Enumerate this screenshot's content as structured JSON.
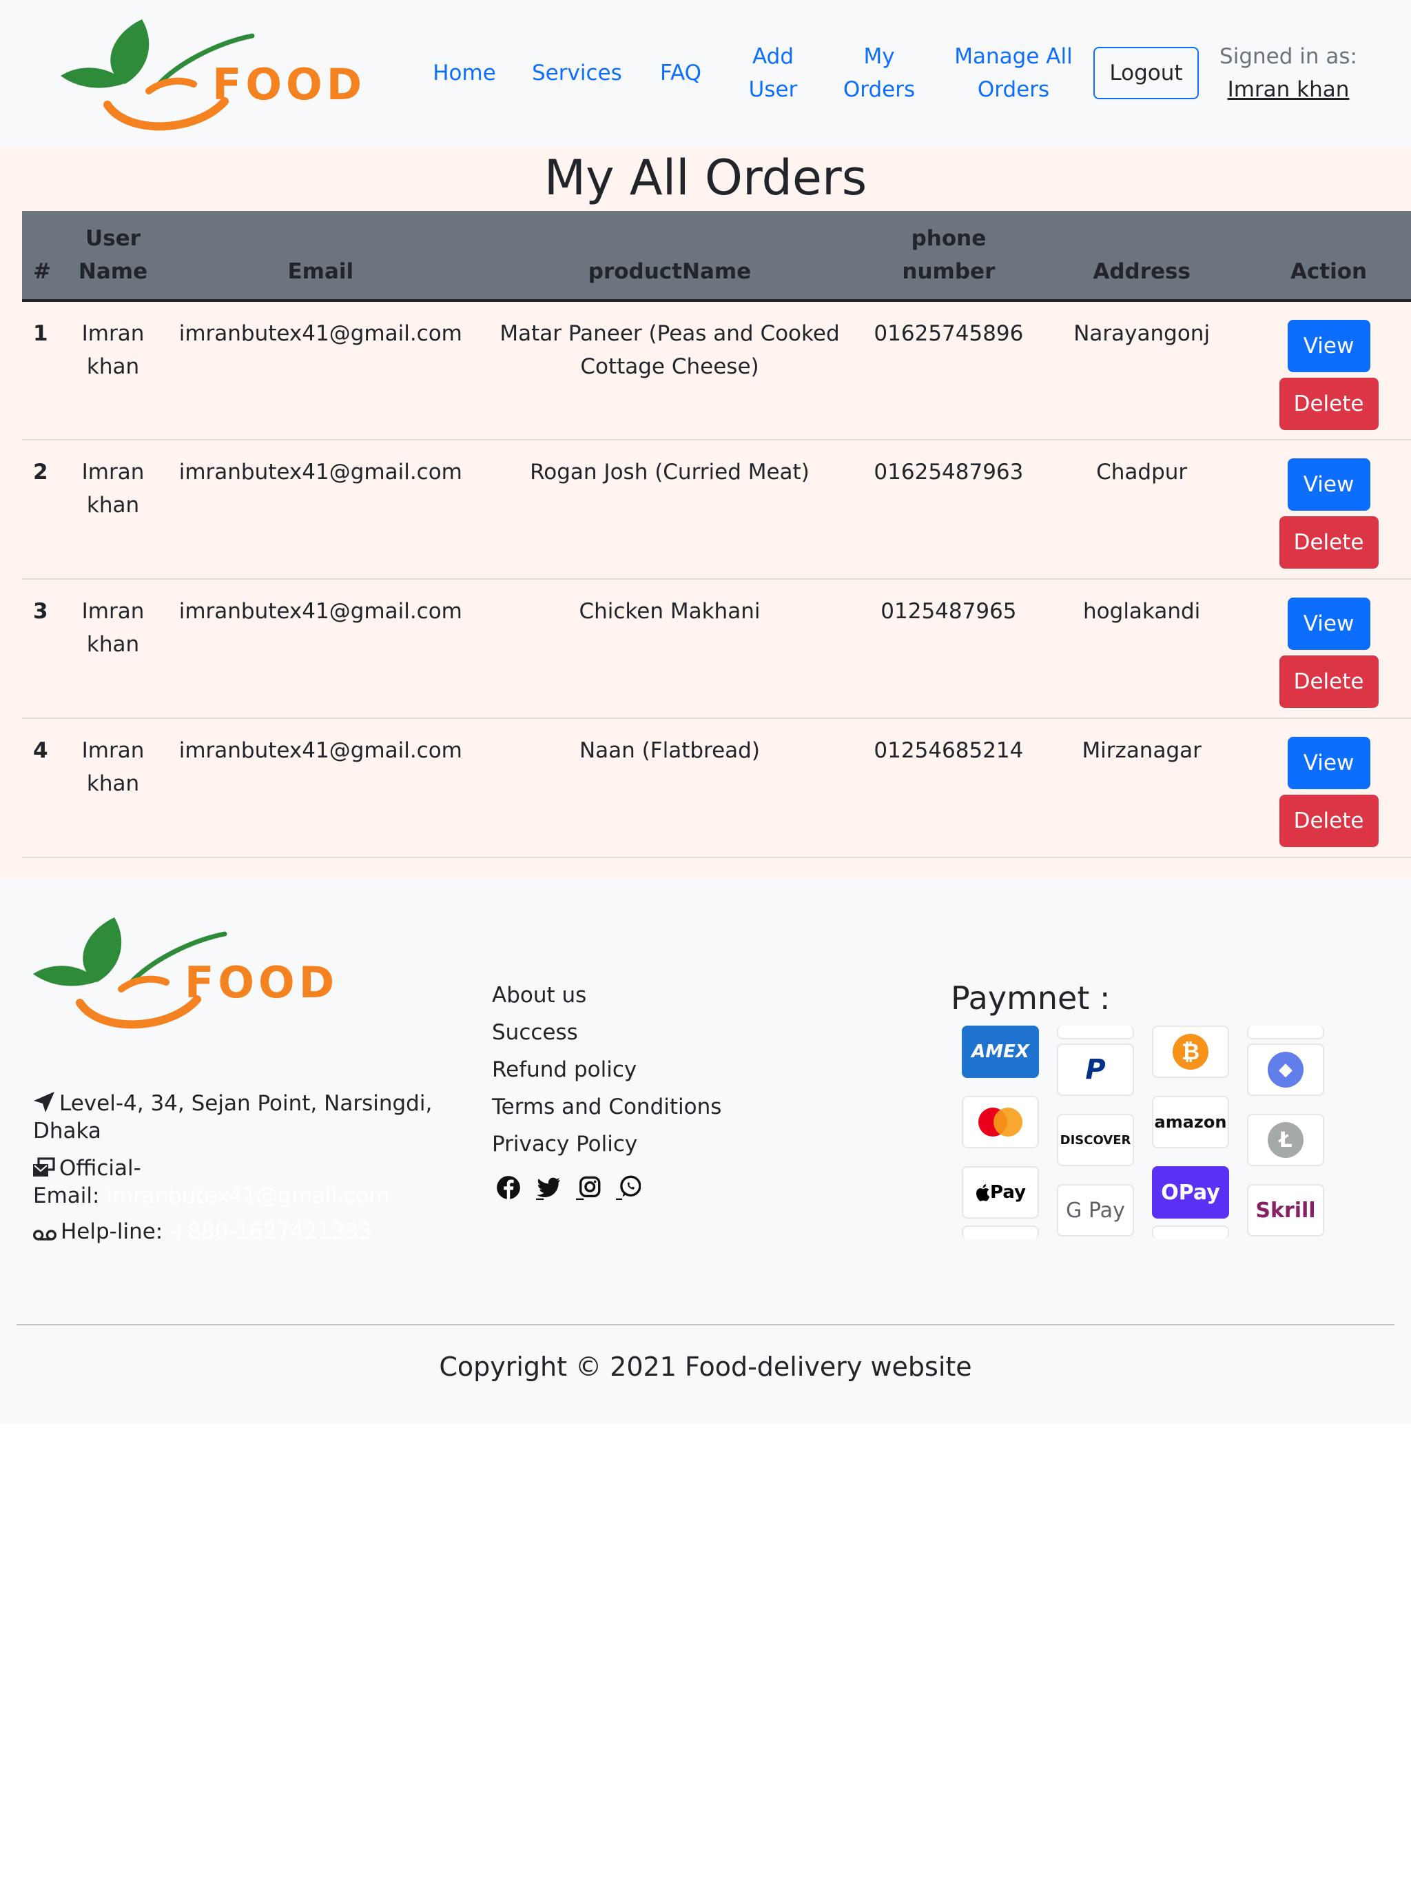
{
  "brand": {
    "name": "FOOD"
  },
  "nav": {
    "home": "Home",
    "services": "Services",
    "faq": "FAQ",
    "add_user_1": "Add",
    "add_user_2": "User",
    "my_orders_1": "My",
    "my_orders_2": "Orders",
    "manage_1": "Manage All",
    "manage_2": "Orders",
    "logout": "Logout",
    "signed_in_label": "Signed in as:",
    "signed_in_user": "Imran khan"
  },
  "page": {
    "title": "My All Orders"
  },
  "table": {
    "headers": {
      "idx": "#",
      "user_1": "User",
      "user_2": "Name",
      "email": "Email",
      "product": "productName",
      "phone_1": "phone",
      "phone_2": "number",
      "address": "Address",
      "action": "Action"
    },
    "view_label": "View",
    "delete_label": "Delete",
    "rows": [
      {
        "idx": "1",
        "name_1": "Imran",
        "name_2": "khan",
        "email": "imranbutex41@gmail.com",
        "product": "Matar Paneer (Peas and Cooked Cottage Cheese)",
        "phone": "01625745896",
        "address": "Narayangonj"
      },
      {
        "idx": "2",
        "name_1": "Imran",
        "name_2": "khan",
        "email": "imranbutex41@gmail.com",
        "product": "Rogan Josh (Curried Meat)",
        "phone": "01625487963",
        "address": "Chadpur"
      },
      {
        "idx": "3",
        "name_1": "Imran",
        "name_2": "khan",
        "email": "imranbutex41@gmail.com",
        "product": "Chicken Makhani",
        "phone": "0125487965",
        "address": "hoglakandi"
      },
      {
        "idx": "4",
        "name_1": "Imran",
        "name_2": "khan",
        "email": "imranbutex41@gmail.com",
        "product": "Naan (Flatbread)",
        "phone": "01254685214",
        "address": "Mirzanagar"
      }
    ]
  },
  "footer": {
    "address_1": "Level-4, 34, Sejan Point, Narsingdi,",
    "address_2": "Dhaka",
    "email_label_1": "Official-",
    "email_label_2": "Email:",
    "email_value": "imranbutex41@gmail.com",
    "helpline_label": "Help-line:",
    "helpline_value": "+880-1627421333",
    "links": [
      "About us",
      "Success",
      "Refund policy",
      "Terms and Conditions",
      "Privacy Policy"
    ],
    "social_icons": [
      "facebook-icon",
      "twitter-icon",
      "instagram-icon",
      "whatsapp-icon"
    ],
    "payment_title": "Paymnet :",
    "payment_cards": {
      "amex": "AMEX",
      "paypal": "P",
      "bitcoin": "₿",
      "ethereum": "◆",
      "mastercard": "",
      "discover": "DISCOVER",
      "amazon": "amazon",
      "litecoin": "Ł",
      "applepay": "Pay",
      "gpay": "G Pay",
      "opay": "OPay",
      "skrill": "Skrill"
    },
    "copyright": "Copyright © 2021 Food-delivery website"
  },
  "colors": {
    "primary": "#0d6efd",
    "danger": "#dc3545",
    "header": "#6c757d",
    "main_bg": "#fff4ef",
    "brand_green": "#2e8b3a",
    "brand_orange": "#f58220"
  }
}
